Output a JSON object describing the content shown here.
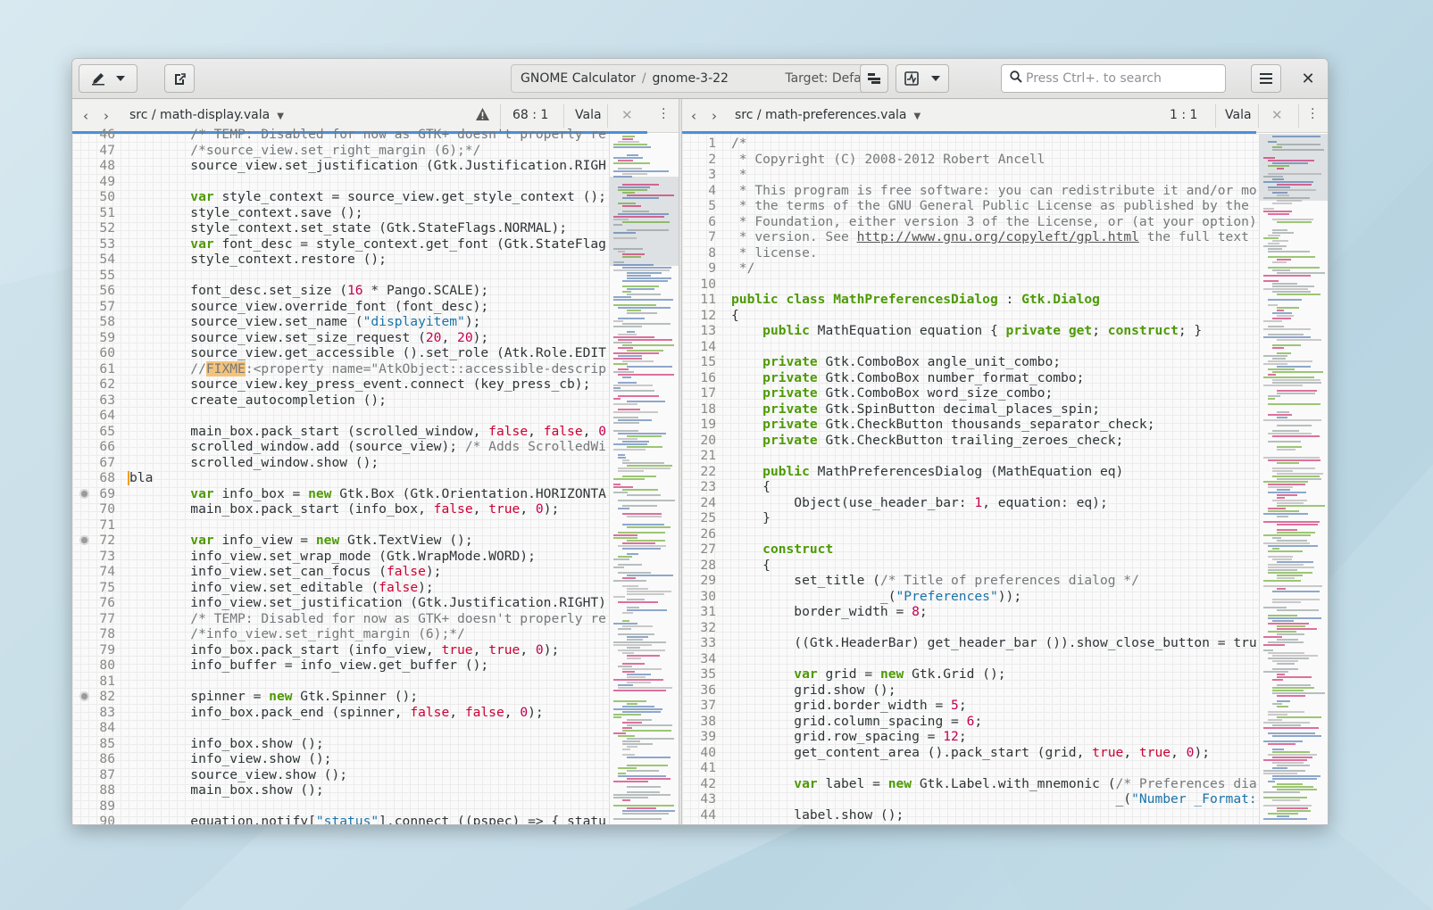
{
  "headerbar": {
    "project": "GNOME Calculator",
    "separator": "/",
    "branch": "gnome-3-22",
    "target": "Target: Default",
    "search_placeholder": "Press Ctrl+. to search",
    "close_glyph": "✕"
  },
  "icons": {
    "edit": "pencil-icon",
    "dropdown": "chevron-down-icon",
    "export": "export-icon",
    "build": "build-icon",
    "monitor": "monitor-icon",
    "search": "search-icon",
    "hamburger": "menu-icon",
    "close": "close-icon",
    "warning": "warning-icon"
  },
  "left_tab": {
    "back": "‹",
    "forward": "›",
    "path": "src / math-display.vala",
    "position": "68 : 1",
    "language": "Vala",
    "close": "✕"
  },
  "right_tab": {
    "back": "‹",
    "forward": "›",
    "path": "src / math-preferences.vala",
    "position": "1 : 1",
    "language": "Vala",
    "close": "✕"
  },
  "colors": {
    "accent": "#4a90d9",
    "keyword": "#4e9a06",
    "number": "#c4004e",
    "string": "#1a73a8",
    "comment": "#75797b",
    "fixme_highlight": "#f5c27a"
  },
  "left_code": [
    {
      "n": "46",
      "t": "        /* TEMP: Disabled for now as GTK+ doesn't properly re"
    },
    {
      "n": "47",
      "t": "        /*source_view.set_right_margin (6);*/"
    },
    {
      "n": "48",
      "t": "        source_view.set_justification (Gtk.Justification.RIGH"
    },
    {
      "n": "49",
      "t": ""
    },
    {
      "n": "50",
      "t": "        var style_context = source_view.get_style_context ();"
    },
    {
      "n": "51",
      "t": "        style_context.save ();"
    },
    {
      "n": "52",
      "t": "        style_context.set_state (Gtk.StateFlags.NORMAL);"
    },
    {
      "n": "53",
      "t": "        var font_desc = style_context.get_font (Gtk.StateFlag"
    },
    {
      "n": "54",
      "t": "        style_context.restore ();"
    },
    {
      "n": "55",
      "t": ""
    },
    {
      "n": "56",
      "t": "        font_desc.set_size (16 * Pango.SCALE);"
    },
    {
      "n": "57",
      "t": "        source_view.override_font (font_desc);"
    },
    {
      "n": "58",
      "t": "        source_view.set_name (\"displayitem\");"
    },
    {
      "n": "59",
      "t": "        source_view.set_size_request (20, 20);"
    },
    {
      "n": "60",
      "t": "        source_view.get_accessible ().set_role (Atk.Role.EDIT"
    },
    {
      "n": "61",
      "t": "        //FIXME:<property name=\"AtkObject::accessible-descrip"
    },
    {
      "n": "62",
      "t": "        source_view.key_press_event.connect (key_press_cb);"
    },
    {
      "n": "63",
      "t": "        create_autocompletion ();"
    },
    {
      "n": "64",
      "t": ""
    },
    {
      "n": "65",
      "t": "        main_box.pack_start (scrolled_window, false, false, 0"
    },
    {
      "n": "66",
      "t": "        scrolled_window.add (source_view); /* Adds ScrolledWi"
    },
    {
      "n": "67",
      "t": "        scrolled_window.show ();"
    },
    {
      "n": "68",
      "t": "bla"
    },
    {
      "n": "69",
      "t": "        var info_box = new Gtk.Box (Gtk.Orientation.HORIZONTA"
    },
    {
      "n": "70",
      "t": "        main_box.pack_start (info_box, false, true, 0);"
    },
    {
      "n": "71",
      "t": ""
    },
    {
      "n": "72",
      "t": "        var info_view = new Gtk.TextView ();"
    },
    {
      "n": "73",
      "t": "        info_view.set_wrap_mode (Gtk.WrapMode.WORD);"
    },
    {
      "n": "74",
      "t": "        info_view.set_can_focus (false);"
    },
    {
      "n": "75",
      "t": "        info_view.set_editable (false);"
    },
    {
      "n": "76",
      "t": "        info_view.set_justification (Gtk.Justification.RIGHT)"
    },
    {
      "n": "77",
      "t": "        /* TEMP: Disabled for now as GTK+ doesn't properly re"
    },
    {
      "n": "78",
      "t": "        /*info_view.set_right_margin (6);*/"
    },
    {
      "n": "79",
      "t": "        info_box.pack_start (info_view, true, true, 0);"
    },
    {
      "n": "80",
      "t": "        info_buffer = info_view.get_buffer ();"
    },
    {
      "n": "81",
      "t": ""
    },
    {
      "n": "82",
      "t": "        spinner = new Gtk.Spinner ();"
    },
    {
      "n": "83",
      "t": "        info_box.pack_end (spinner, false, false, 0);"
    },
    {
      "n": "84",
      "t": ""
    },
    {
      "n": "85",
      "t": "        info_box.show ();"
    },
    {
      "n": "86",
      "t": "        info_view.show ();"
    },
    {
      "n": "87",
      "t": "        source_view.show ();"
    },
    {
      "n": "88",
      "t": "        main_box.show ();"
    },
    {
      "n": "89",
      "t": ""
    },
    {
      "n": "90",
      "t": "        equation.notify[\"status\"].connect ((pspec) => { statu"
    }
  ],
  "right_code": [
    {
      "n": "1",
      "t": "/*"
    },
    {
      "n": "2",
      "t": " * Copyright (C) 2008-2012 Robert Ancell"
    },
    {
      "n": "3",
      "t": " *"
    },
    {
      "n": "4",
      "t": " * This program is free software: you can redistribute it and/or mo"
    },
    {
      "n": "5",
      "t": " * the terms of the GNU General Public License as published by the"
    },
    {
      "n": "6",
      "t": " * Foundation, either version 3 of the License, or (at your option)"
    },
    {
      "n": "7",
      "t": " * version. See http://www.gnu.org/copyleft/gpl.html the full text"
    },
    {
      "n": "8",
      "t": " * license."
    },
    {
      "n": "9",
      "t": " */"
    },
    {
      "n": "10",
      "t": ""
    },
    {
      "n": "11",
      "t": "public class MathPreferencesDialog : Gtk.Dialog"
    },
    {
      "n": "12",
      "t": "{"
    },
    {
      "n": "13",
      "t": "    public MathEquation equation { private get; construct; }"
    },
    {
      "n": "14",
      "t": ""
    },
    {
      "n": "15",
      "t": "    private Gtk.ComboBox angle_unit_combo;"
    },
    {
      "n": "16",
      "t": "    private Gtk.ComboBox number_format_combo;"
    },
    {
      "n": "17",
      "t": "    private Gtk.ComboBox word_size_combo;"
    },
    {
      "n": "18",
      "t": "    private Gtk.SpinButton decimal_places_spin;"
    },
    {
      "n": "19",
      "t": "    private Gtk.CheckButton thousands_separator_check;"
    },
    {
      "n": "20",
      "t": "    private Gtk.CheckButton trailing_zeroes_check;"
    },
    {
      "n": "21",
      "t": ""
    },
    {
      "n": "22",
      "t": "    public MathPreferencesDialog (MathEquation eq)"
    },
    {
      "n": "23",
      "t": "    {"
    },
    {
      "n": "24",
      "t": "        Object(use_header_bar: 1, equation: eq);"
    },
    {
      "n": "25",
      "t": "    }"
    },
    {
      "n": "26",
      "t": ""
    },
    {
      "n": "27",
      "t": "    construct"
    },
    {
      "n": "28",
      "t": "    {"
    },
    {
      "n": "29",
      "t": "        set_title (/* Title of preferences dialog */"
    },
    {
      "n": "30",
      "t": "                   _(\"Preferences\"));"
    },
    {
      "n": "31",
      "t": "        border_width = 8;"
    },
    {
      "n": "32",
      "t": ""
    },
    {
      "n": "33",
      "t": "        ((Gtk.HeaderBar) get_header_bar ()).show_close_button = tru"
    },
    {
      "n": "34",
      "t": ""
    },
    {
      "n": "35",
      "t": "        var grid = new Gtk.Grid ();"
    },
    {
      "n": "36",
      "t": "        grid.show ();"
    },
    {
      "n": "37",
      "t": "        grid.border_width = 5;"
    },
    {
      "n": "38",
      "t": "        grid.column_spacing = 6;"
    },
    {
      "n": "39",
      "t": "        grid.row_spacing = 12;"
    },
    {
      "n": "40",
      "t": "        get_content_area ().pack_start (grid, true, true, 0);"
    },
    {
      "n": "41",
      "t": ""
    },
    {
      "n": "42",
      "t": "        var label = new Gtk.Label.with_mnemonic (/* Preferences dia"
    },
    {
      "n": "43",
      "t": "                                                 _(\"Number _Format:"
    },
    {
      "n": "44",
      "t": "        label.show ();"
    }
  ]
}
